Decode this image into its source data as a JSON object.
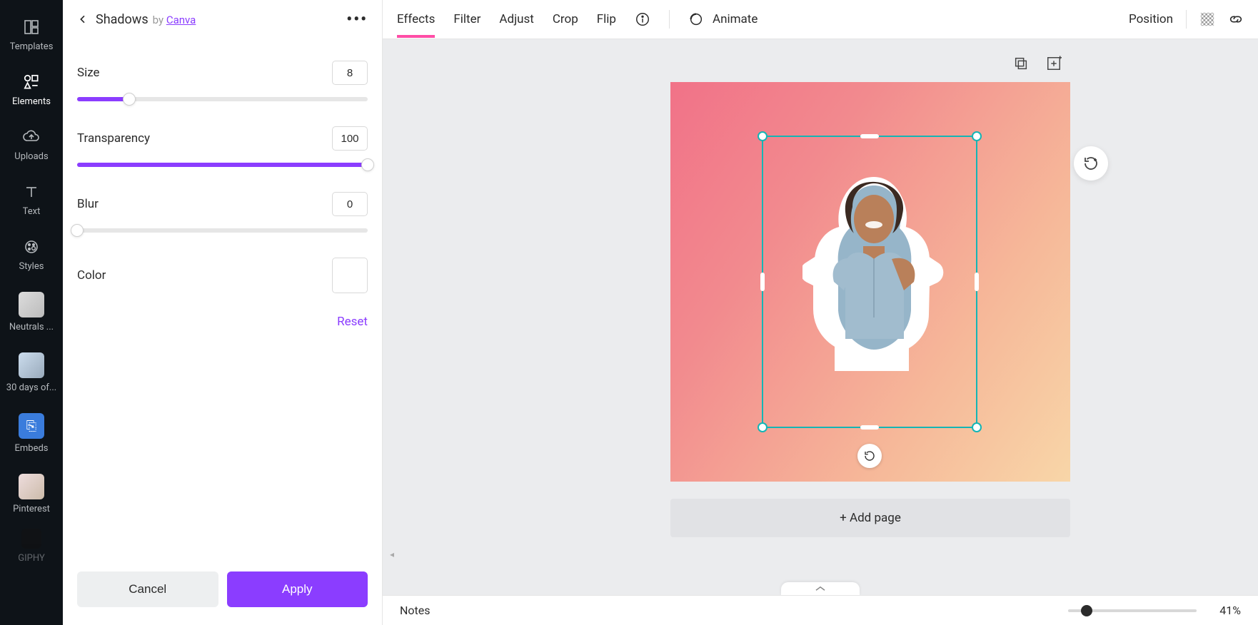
{
  "sidebar": {
    "items": [
      {
        "label": "Templates"
      },
      {
        "label": "Elements"
      },
      {
        "label": "Uploads"
      },
      {
        "label": "Text"
      },
      {
        "label": "Styles"
      },
      {
        "label": "Neutrals ..."
      },
      {
        "label": "30 days of..."
      },
      {
        "label": "Embeds"
      },
      {
        "label": "Pinterest"
      },
      {
        "label": "GIPHY"
      }
    ]
  },
  "panel": {
    "title": "Shadows",
    "by_prefix": "by ",
    "by_link": "Canva",
    "more_symbol": "•••",
    "controls": {
      "size": {
        "label": "Size",
        "value": "8",
        "percent": 18
      },
      "transparency": {
        "label": "Transparency",
        "value": "100",
        "percent": 100
      },
      "blur": {
        "label": "Blur",
        "value": "0",
        "percent": 0
      }
    },
    "color_label": "Color",
    "color_value": "#ffffff",
    "reset_label": "Reset",
    "cancel_label": "Cancel",
    "apply_label": "Apply"
  },
  "toolbar": {
    "effects": "Effects",
    "filter": "Filter",
    "adjust": "Adjust",
    "crop": "Crop",
    "flip": "Flip",
    "animate": "Animate",
    "position": "Position",
    "active": "effects"
  },
  "canvas": {
    "add_page_label": "+ Add page"
  },
  "bottom": {
    "notes_label": "Notes",
    "zoom_value": "41%",
    "zoom_percent_on_track": 10
  }
}
